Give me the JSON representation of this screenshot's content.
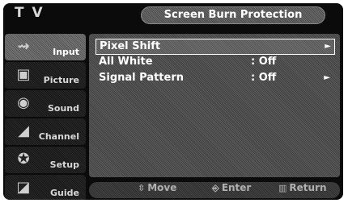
{
  "header": {
    "tv_label": "T V",
    "menu_title": "Screen Burn Protection"
  },
  "sidebar": {
    "items": [
      {
        "label": "Input",
        "icon": "input-icon",
        "glyph": "⇝"
      },
      {
        "label": "Picture",
        "icon": "picture-icon",
        "glyph": "▣"
      },
      {
        "label": "Sound",
        "icon": "sound-icon",
        "glyph": "◉"
      },
      {
        "label": "Channel",
        "icon": "channel-icon",
        "glyph": "◢"
      },
      {
        "label": "Setup",
        "icon": "setup-icon",
        "glyph": "✪"
      },
      {
        "label": "Guide",
        "icon": "guide-icon",
        "glyph": "◪"
      }
    ]
  },
  "menu": {
    "items": [
      {
        "label": "Pixel Shift",
        "value": "",
        "arrow": "►"
      },
      {
        "label": "All White",
        "value": ": Off",
        "arrow": ""
      },
      {
        "label": "Signal Pattern",
        "value": ": Off",
        "arrow": "►"
      }
    ]
  },
  "footer": {
    "move": {
      "icon": "⇳",
      "label": "Move"
    },
    "enter": {
      "icon": "⎆",
      "label": "Enter"
    },
    "return": {
      "icon": "▥",
      "label": "Return"
    }
  },
  "colors": {
    "background": "#0b0b0b",
    "panel": "#4e4e4e",
    "text": "#ffffff"
  }
}
